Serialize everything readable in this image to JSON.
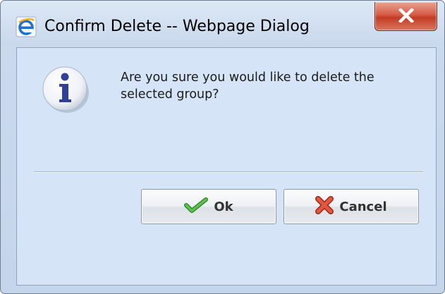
{
  "window": {
    "title": "Confirm Delete -- Webpage Dialog",
    "icons": {
      "app": "internet-explorer-icon",
      "close": "close-icon"
    }
  },
  "dialog": {
    "icon": "info-icon",
    "message": "Are you sure you would like to delete the selected group?"
  },
  "buttons": {
    "ok": {
      "label": "Ok",
      "icon": "checkmark-icon"
    },
    "cancel": {
      "label": "Cancel",
      "icon": "x-mark-icon"
    }
  },
  "colors": {
    "client_background": "#d5e5f7",
    "close_button": "#c33b24",
    "info_icon": "#2f3f9a",
    "check_icon": "#3aa32c",
    "cancel_icon": "#d2442e"
  }
}
